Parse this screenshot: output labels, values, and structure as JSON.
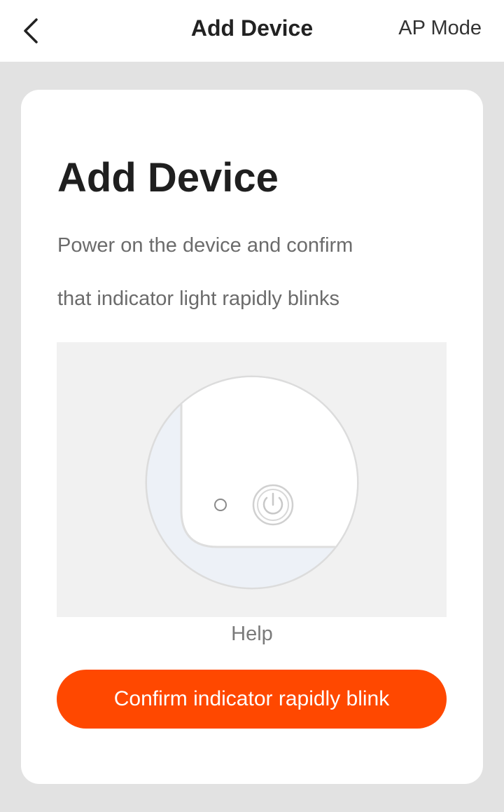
{
  "header": {
    "back_icon": "chevron-left-icon",
    "title": "Add Device",
    "ap_mode_label": "AP Mode"
  },
  "card": {
    "title": "Add Device",
    "instruction_line1": "Power on the device and confirm",
    "instruction_line2": "that indicator light rapidly blinks",
    "illustration_icons": [
      "indicator-light-icon",
      "power-icon"
    ],
    "help_label": "Help",
    "confirm_label": "Confirm indicator rapidly blink"
  },
  "colors": {
    "accent": "#ff4800",
    "background": "#e2e2e2",
    "card": "#ffffff"
  }
}
